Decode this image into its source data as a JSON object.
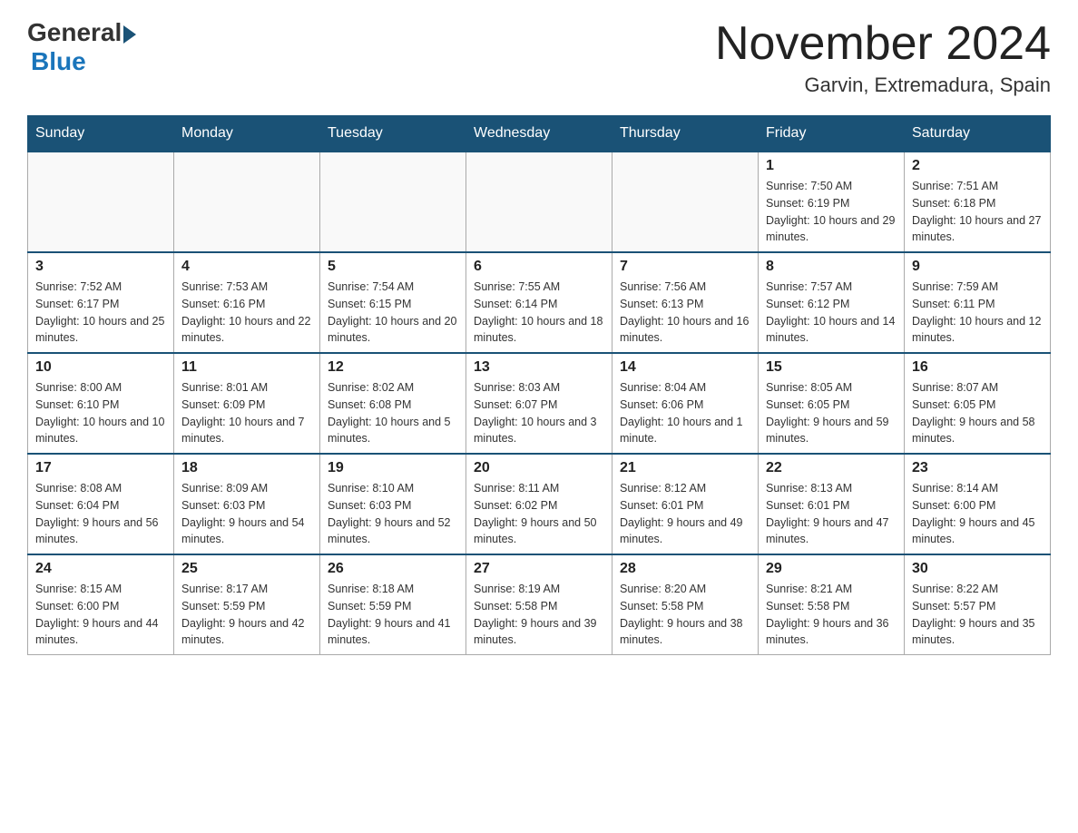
{
  "header": {
    "logo_general": "General",
    "logo_blue": "Blue",
    "month_title": "November 2024",
    "location": "Garvin, Extremadura, Spain"
  },
  "weekdays": [
    "Sunday",
    "Monday",
    "Tuesday",
    "Wednesday",
    "Thursday",
    "Friday",
    "Saturday"
  ],
  "weeks": [
    [
      {
        "day": "",
        "sunrise": "",
        "sunset": "",
        "daylight": ""
      },
      {
        "day": "",
        "sunrise": "",
        "sunset": "",
        "daylight": ""
      },
      {
        "day": "",
        "sunrise": "",
        "sunset": "",
        "daylight": ""
      },
      {
        "day": "",
        "sunrise": "",
        "sunset": "",
        "daylight": ""
      },
      {
        "day": "",
        "sunrise": "",
        "sunset": "",
        "daylight": ""
      },
      {
        "day": "1",
        "sunrise": "Sunrise: 7:50 AM",
        "sunset": "Sunset: 6:19 PM",
        "daylight": "Daylight: 10 hours and 29 minutes."
      },
      {
        "day": "2",
        "sunrise": "Sunrise: 7:51 AM",
        "sunset": "Sunset: 6:18 PM",
        "daylight": "Daylight: 10 hours and 27 minutes."
      }
    ],
    [
      {
        "day": "3",
        "sunrise": "Sunrise: 7:52 AM",
        "sunset": "Sunset: 6:17 PM",
        "daylight": "Daylight: 10 hours and 25 minutes."
      },
      {
        "day": "4",
        "sunrise": "Sunrise: 7:53 AM",
        "sunset": "Sunset: 6:16 PM",
        "daylight": "Daylight: 10 hours and 22 minutes."
      },
      {
        "day": "5",
        "sunrise": "Sunrise: 7:54 AM",
        "sunset": "Sunset: 6:15 PM",
        "daylight": "Daylight: 10 hours and 20 minutes."
      },
      {
        "day": "6",
        "sunrise": "Sunrise: 7:55 AM",
        "sunset": "Sunset: 6:14 PM",
        "daylight": "Daylight: 10 hours and 18 minutes."
      },
      {
        "day": "7",
        "sunrise": "Sunrise: 7:56 AM",
        "sunset": "Sunset: 6:13 PM",
        "daylight": "Daylight: 10 hours and 16 minutes."
      },
      {
        "day": "8",
        "sunrise": "Sunrise: 7:57 AM",
        "sunset": "Sunset: 6:12 PM",
        "daylight": "Daylight: 10 hours and 14 minutes."
      },
      {
        "day": "9",
        "sunrise": "Sunrise: 7:59 AM",
        "sunset": "Sunset: 6:11 PM",
        "daylight": "Daylight: 10 hours and 12 minutes."
      }
    ],
    [
      {
        "day": "10",
        "sunrise": "Sunrise: 8:00 AM",
        "sunset": "Sunset: 6:10 PM",
        "daylight": "Daylight: 10 hours and 10 minutes."
      },
      {
        "day": "11",
        "sunrise": "Sunrise: 8:01 AM",
        "sunset": "Sunset: 6:09 PM",
        "daylight": "Daylight: 10 hours and 7 minutes."
      },
      {
        "day": "12",
        "sunrise": "Sunrise: 8:02 AM",
        "sunset": "Sunset: 6:08 PM",
        "daylight": "Daylight: 10 hours and 5 minutes."
      },
      {
        "day": "13",
        "sunrise": "Sunrise: 8:03 AM",
        "sunset": "Sunset: 6:07 PM",
        "daylight": "Daylight: 10 hours and 3 minutes."
      },
      {
        "day": "14",
        "sunrise": "Sunrise: 8:04 AM",
        "sunset": "Sunset: 6:06 PM",
        "daylight": "Daylight: 10 hours and 1 minute."
      },
      {
        "day": "15",
        "sunrise": "Sunrise: 8:05 AM",
        "sunset": "Sunset: 6:05 PM",
        "daylight": "Daylight: 9 hours and 59 minutes."
      },
      {
        "day": "16",
        "sunrise": "Sunrise: 8:07 AM",
        "sunset": "Sunset: 6:05 PM",
        "daylight": "Daylight: 9 hours and 58 minutes."
      }
    ],
    [
      {
        "day": "17",
        "sunrise": "Sunrise: 8:08 AM",
        "sunset": "Sunset: 6:04 PM",
        "daylight": "Daylight: 9 hours and 56 minutes."
      },
      {
        "day": "18",
        "sunrise": "Sunrise: 8:09 AM",
        "sunset": "Sunset: 6:03 PM",
        "daylight": "Daylight: 9 hours and 54 minutes."
      },
      {
        "day": "19",
        "sunrise": "Sunrise: 8:10 AM",
        "sunset": "Sunset: 6:03 PM",
        "daylight": "Daylight: 9 hours and 52 minutes."
      },
      {
        "day": "20",
        "sunrise": "Sunrise: 8:11 AM",
        "sunset": "Sunset: 6:02 PM",
        "daylight": "Daylight: 9 hours and 50 minutes."
      },
      {
        "day": "21",
        "sunrise": "Sunrise: 8:12 AM",
        "sunset": "Sunset: 6:01 PM",
        "daylight": "Daylight: 9 hours and 49 minutes."
      },
      {
        "day": "22",
        "sunrise": "Sunrise: 8:13 AM",
        "sunset": "Sunset: 6:01 PM",
        "daylight": "Daylight: 9 hours and 47 minutes."
      },
      {
        "day": "23",
        "sunrise": "Sunrise: 8:14 AM",
        "sunset": "Sunset: 6:00 PM",
        "daylight": "Daylight: 9 hours and 45 minutes."
      }
    ],
    [
      {
        "day": "24",
        "sunrise": "Sunrise: 8:15 AM",
        "sunset": "Sunset: 6:00 PM",
        "daylight": "Daylight: 9 hours and 44 minutes."
      },
      {
        "day": "25",
        "sunrise": "Sunrise: 8:17 AM",
        "sunset": "Sunset: 5:59 PM",
        "daylight": "Daylight: 9 hours and 42 minutes."
      },
      {
        "day": "26",
        "sunrise": "Sunrise: 8:18 AM",
        "sunset": "Sunset: 5:59 PM",
        "daylight": "Daylight: 9 hours and 41 minutes."
      },
      {
        "day": "27",
        "sunrise": "Sunrise: 8:19 AM",
        "sunset": "Sunset: 5:58 PM",
        "daylight": "Daylight: 9 hours and 39 minutes."
      },
      {
        "day": "28",
        "sunrise": "Sunrise: 8:20 AM",
        "sunset": "Sunset: 5:58 PM",
        "daylight": "Daylight: 9 hours and 38 minutes."
      },
      {
        "day": "29",
        "sunrise": "Sunrise: 8:21 AM",
        "sunset": "Sunset: 5:58 PM",
        "daylight": "Daylight: 9 hours and 36 minutes."
      },
      {
        "day": "30",
        "sunrise": "Sunrise: 8:22 AM",
        "sunset": "Sunset: 5:57 PM",
        "daylight": "Daylight: 9 hours and 35 minutes."
      }
    ]
  ]
}
